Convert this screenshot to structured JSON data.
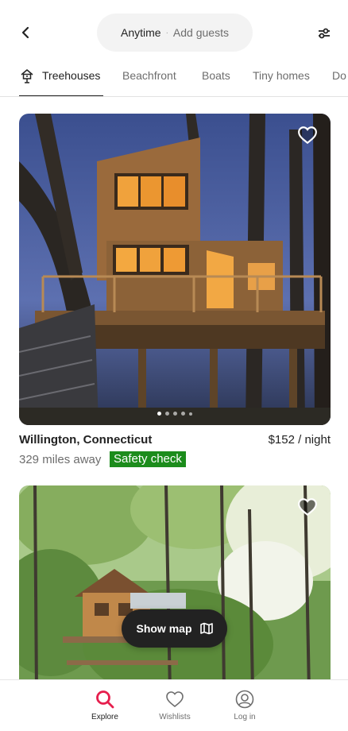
{
  "header": {
    "search": {
      "when": "Anytime",
      "separator": "·",
      "who": "Add guests"
    },
    "icons": {
      "back": "chevron-left-icon",
      "filter": "sliders-icon"
    }
  },
  "categories": [
    {
      "label": "Treehouses",
      "active": true,
      "icon": "treehouse-icon"
    },
    {
      "label": "Beachfront",
      "active": false
    },
    {
      "label": "Boats",
      "active": false
    },
    {
      "label": "Tiny homes",
      "active": false
    },
    {
      "label": "Do",
      "active": false
    }
  ],
  "listings": [
    {
      "location": "Willington, Connecticut",
      "price": "$152 / night",
      "distance": "329 miles away",
      "badge": "Safety check",
      "photo_count": 5,
      "photo_index": 1
    }
  ],
  "show_map": {
    "label": "Show map",
    "icon": "map-icon"
  },
  "bottom_nav": [
    {
      "label": "Explore",
      "icon": "search-icon",
      "active": true
    },
    {
      "label": "Wishlists",
      "icon": "heart-icon",
      "active": false
    },
    {
      "label": "Log in",
      "icon": "user-circle-icon",
      "active": false
    }
  ],
  "colors": {
    "accent": "#e61e4d",
    "badge_green": "#1c8c1c",
    "text_primary": "#222222",
    "text_secondary": "#6d6d6d"
  }
}
